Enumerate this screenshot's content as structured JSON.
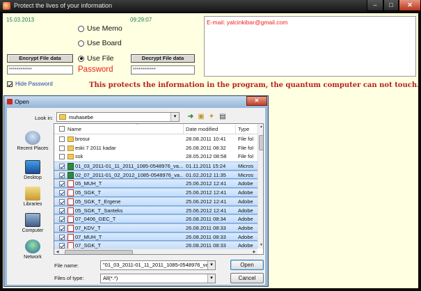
{
  "main": {
    "title": "Protect the lives of your information",
    "window_buttons": {
      "minimize": "–",
      "maximize": "□",
      "close": "✕"
    },
    "date": "15.03.2013",
    "time": "09:29:07",
    "modes": [
      "Use Memo",
      "Use Board",
      "Use File"
    ],
    "selected_mode": "Use File",
    "encrypt_label": "Encrypt  File data",
    "decrypt_label": "Decrypt  File data",
    "password_label": "Password",
    "password_left": "************",
    "password_right": "************",
    "email_text": "E-mail: yalcinkibar@gmail.com",
    "hide_password_label": "Hide Password",
    "hide_password_checked": true,
    "banner": "This protects the information in the program, the quantum computer can not touch.",
    "colors": {
      "background": "#ffffe1",
      "accent_red": "#ee1b1b",
      "banner": "#b52020",
      "date_green": "#1d7a56",
      "link_blue": "#1f3fb0"
    }
  },
  "dialog": {
    "title": "Open",
    "close_glyph": "✕",
    "look_in_label": "Look in:",
    "look_in_value": "muhasebe",
    "dropdown_glyph": "▾",
    "toolbar": {
      "back": "➜",
      "up": "▣",
      "new_folder": "✦",
      "views": "▤"
    },
    "places": [
      "Recent Places",
      "Desktop",
      "Libraries",
      "Computer",
      "Network"
    ],
    "columns": {
      "name": "Name",
      "date": "Date modified",
      "type": "Type"
    },
    "files": [
      {
        "icon": "folder",
        "name": "brosur",
        "date": "28.08.2011 10:41",
        "type": "File fol",
        "checked": false,
        "selected": false
      },
      {
        "icon": "folder",
        "name": "eski 7 2011 kadar",
        "date": "26.08.2011 08:32",
        "type": "File fol",
        "checked": false,
        "selected": false
      },
      {
        "icon": "folder",
        "name": "ssk",
        "date": "28.05.2012 08:58",
        "type": "File fol",
        "checked": false,
        "selected": false
      },
      {
        "icon": "excel",
        "name": "01_03_2011-01_11_2011_1085-0548976_va...",
        "date": "01.11.2011 15:24",
        "type": "Micros",
        "checked": true,
        "selected": true
      },
      {
        "icon": "excel",
        "name": "02_07_2011-01_02_2012_1085-0548976_va...",
        "date": "01.02.2012 11:35",
        "type": "Micros",
        "checked": true,
        "selected": true
      },
      {
        "icon": "pdf",
        "name": "05_MUH_T",
        "date": "25.06.2012 12:41",
        "type": "Adobe",
        "checked": true,
        "selected": true
      },
      {
        "icon": "pdf",
        "name": "05_SGK_T",
        "date": "25.06.2012 12:41",
        "type": "Adobe",
        "checked": true,
        "selected": true
      },
      {
        "icon": "pdf",
        "name": "05_SGK_T_Ergene",
        "date": "25.06.2012 12:41",
        "type": "Adobe",
        "checked": true,
        "selected": true
      },
      {
        "icon": "pdf",
        "name": "05_SGK_T_Santeks",
        "date": "25.06.2012 12:41",
        "type": "Adobe",
        "checked": true,
        "selected": true
      },
      {
        "icon": "pdf",
        "name": "07_0406_GEC_T",
        "date": "26.08.2011 08:34",
        "type": "Adobe",
        "checked": true,
        "selected": true
      },
      {
        "icon": "pdf",
        "name": "07_KDV_T",
        "date": "26.08.2011 08:33",
        "type": "Adobe",
        "checked": true,
        "selected": true
      },
      {
        "icon": "pdf",
        "name": "07_MUH_T",
        "date": "26.08.2011 08:33",
        "type": "Adobe",
        "checked": true,
        "selected": true
      },
      {
        "icon": "pdf",
        "name": "07_SGK_T",
        "date": "26.08.2011 08:33",
        "type": "Adobe",
        "checked": true,
        "selected": true
      }
    ],
    "scroll_glyphs": {
      "up": "▲",
      "down": "▼",
      "left": "◀",
      "right": "▶",
      "sort": "^"
    },
    "file_name_label": "File name:",
    "file_name_value": "\"01_03_2011-01_11_2011_1085-0548976_vad",
    "files_of_type_label": "Files of type:",
    "files_of_type_value": "All(*.*)",
    "open_label": "Open",
    "cancel_label": "Cancel"
  }
}
